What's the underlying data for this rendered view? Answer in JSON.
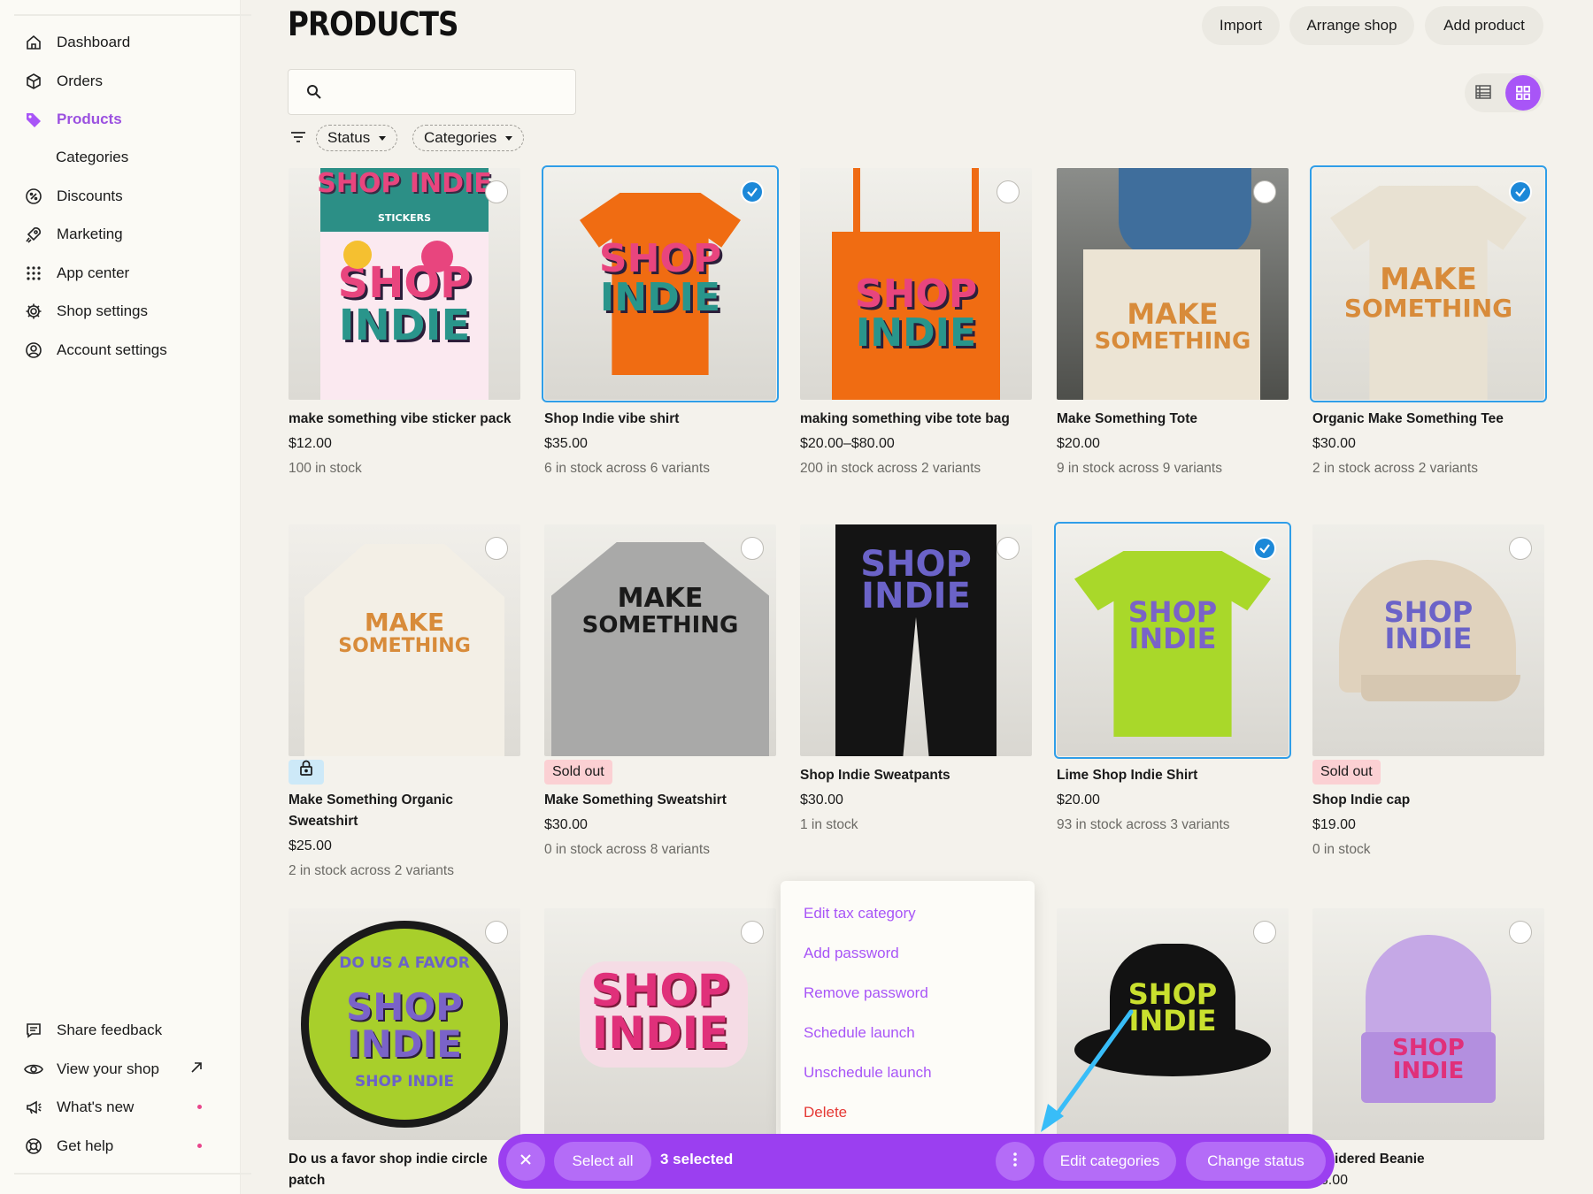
{
  "sidebar": {
    "items": [
      {
        "label": "Dashboard",
        "icon": "home-icon"
      },
      {
        "label": "Orders",
        "icon": "box-icon"
      },
      {
        "label": "Products",
        "icon": "tag-icon",
        "active": true
      },
      {
        "label": "Categories",
        "sub": true
      },
      {
        "label": "Discounts",
        "icon": "discount-icon"
      },
      {
        "label": "Marketing",
        "icon": "rocket-icon"
      },
      {
        "label": "App center",
        "icon": "grid-dots-icon"
      },
      {
        "label": "Shop settings",
        "icon": "gear-icon"
      },
      {
        "label": "Account settings",
        "icon": "user-circle-icon"
      }
    ],
    "footer": [
      {
        "label": "Share feedback",
        "icon": "feedback-icon"
      },
      {
        "label": "View your shop",
        "icon": "eye-icon"
      },
      {
        "label": "What's new",
        "icon": "megaphone-icon"
      },
      {
        "label": "Get help",
        "icon": "lifebuoy-icon"
      }
    ]
  },
  "header": {
    "title": "PRODUCTS",
    "import_label": "Import",
    "arrange_label": "Arrange shop",
    "add_label": "Add product"
  },
  "search": {
    "placeholder": ""
  },
  "filters": {
    "status_label": "Status",
    "categories_label": "Categories"
  },
  "accent": "#a855f7",
  "products": [
    {
      "name": "make something vibe sticker pack",
      "price": "$12.00",
      "stock": "100 in stock",
      "selected": false
    },
    {
      "name": "Shop Indie vibe shirt",
      "price": "$35.00",
      "stock": "6 in stock across 6 variants",
      "selected": true
    },
    {
      "name": "making something vibe tote bag",
      "price": "$20.00–$80.00",
      "stock": "200 in stock across 2 variants",
      "selected": false
    },
    {
      "name": "Make Something Tote",
      "price": "$20.00",
      "stock": "9 in stock across 9 variants",
      "selected": false
    },
    {
      "name": "Organic Make Something Tee",
      "price": "$30.00",
      "stock": "2 in stock across 2 variants",
      "selected": true
    },
    {
      "name": "Make Something Organic Sweatshirt",
      "price": "$25.00",
      "stock": "2 in stock across 2 variants",
      "badge": "lock-icon",
      "selected": false
    },
    {
      "name": "Make Something Sweatshirt",
      "price": "$30.00",
      "stock": "0 in stock across 8 variants",
      "badge": "Sold out",
      "selected": false
    },
    {
      "name": "Shop Indie Sweatpants",
      "price": "$30.00",
      "stock": "1 in stock",
      "selected": false
    },
    {
      "name": "Lime Shop Indie Shirt",
      "price": "$20.00",
      "stock": "93 in stock across 3 variants",
      "selected": true
    },
    {
      "name": "Shop Indie cap",
      "price": "$19.00",
      "stock": "0 in stock",
      "badge": "Sold out",
      "selected": false
    },
    {
      "name": "Do us a favor shop indie circle patch",
      "selected": false
    },
    {
      "name": "",
      "selected": false
    },
    {
      "name": "",
      "selected": false
    },
    {
      "name": "broidered Beanie",
      "price": "16.00",
      "selected": false
    }
  ],
  "artwork": {
    "sticker_header": "SHOP INDIE",
    "sticker_sub": "STICKERS",
    "shop": "SHOP",
    "indie": "INDIE",
    "make": "MAKE",
    "something": "SOMETHING",
    "patch_top": "DO US A FAVOR",
    "patch_bottom": "SHOP INDIE"
  },
  "context_menu": {
    "items": [
      "Edit tax category",
      "Add password",
      "Remove password",
      "Schedule launch",
      "Unschedule launch",
      "Delete"
    ]
  },
  "bulk_bar": {
    "select_all": "Select all",
    "selected_count": "3 selected",
    "edit_categories": "Edit categories",
    "change_status": "Change status"
  }
}
